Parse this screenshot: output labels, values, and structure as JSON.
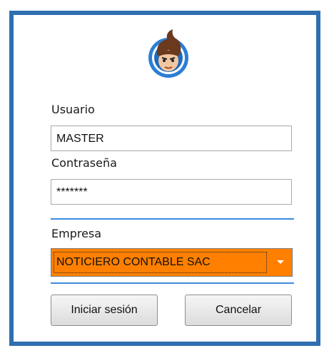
{
  "login": {
    "user_label": "Usuario",
    "user_value": "MASTER",
    "password_label": "Contraseña",
    "password_value": "*******",
    "company_label": "Empresa",
    "company_value": "NOTICIERO CONTABLE SAC",
    "login_button": "Iniciar sesión",
    "cancel_button": "Cancelar"
  },
  "colors": {
    "frame": "#2f6fb0",
    "separator": "#3b8ce0",
    "company_highlight": "#ff8000"
  },
  "icons": {
    "logo": "mascot-avatar-icon",
    "dropdown": "chevron-down-icon"
  }
}
